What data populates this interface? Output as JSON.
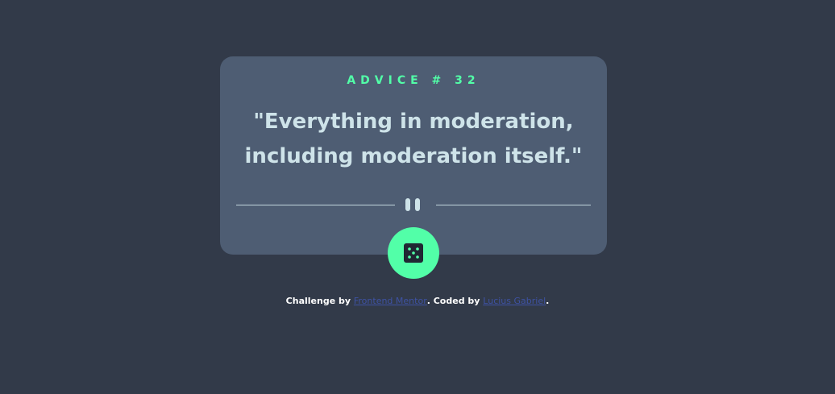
{
  "advice": {
    "label": "ADVICE # 32",
    "quote": "\"Everything in moderation, including moderation itself.\""
  },
  "icons": {
    "divider": "pause-icon",
    "button": "dice-icon"
  },
  "attribution": {
    "prefix": "Challenge by ",
    "link1": "Frontend Mentor",
    "middle": ". Coded by ",
    "link2": "Lucius Gabriel",
    "suffix": "."
  },
  "colors": {
    "background": "#323a49",
    "card": "#4e5d73",
    "accent": "#52ffa8",
    "text": "#cee3e9",
    "link": "#3e52a3"
  }
}
